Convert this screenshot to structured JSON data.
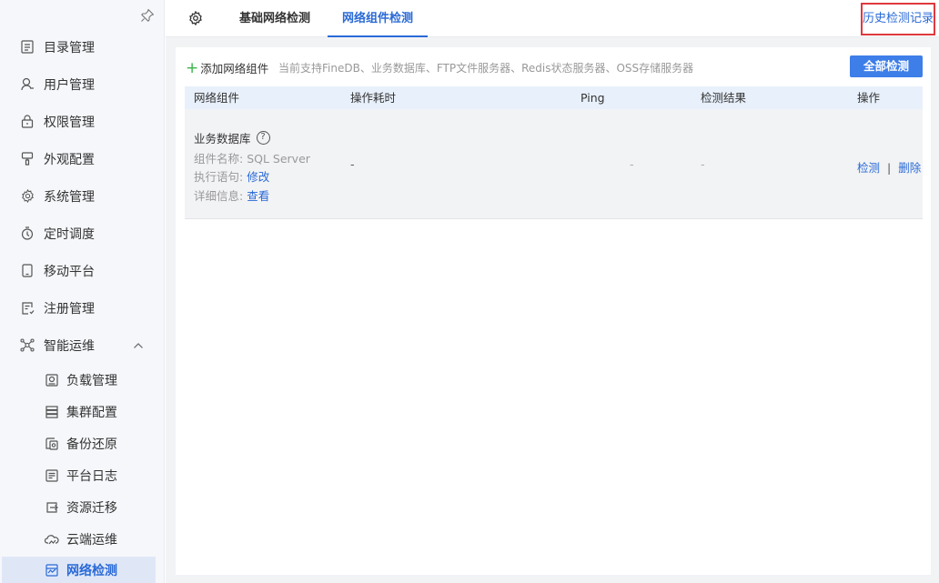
{
  "sidebar": {
    "items": [
      {
        "label": "目录管理",
        "icon": "catalog-icon"
      },
      {
        "label": "用户管理",
        "icon": "user-icon"
      },
      {
        "label": "权限管理",
        "icon": "lock-icon"
      },
      {
        "label": "外观配置",
        "icon": "brush-icon"
      },
      {
        "label": "系统管理",
        "icon": "gear-icon"
      },
      {
        "label": "定时调度",
        "icon": "timer-icon"
      },
      {
        "label": "移动平台",
        "icon": "mobile-icon"
      },
      {
        "label": "注册管理",
        "icon": "register-icon"
      },
      {
        "label": "智能运维",
        "icon": "ops-icon"
      }
    ],
    "sub_items": [
      {
        "label": "负载管理",
        "icon": "load-icon"
      },
      {
        "label": "集群配置",
        "icon": "cluster-icon"
      },
      {
        "label": "备份还原",
        "icon": "backup-icon"
      },
      {
        "label": "平台日志",
        "icon": "log-icon"
      },
      {
        "label": "资源迁移",
        "icon": "migrate-icon"
      },
      {
        "label": "云端运维",
        "icon": "cloud-icon"
      },
      {
        "label": "网络检测",
        "icon": "network-icon"
      }
    ]
  },
  "tabs": {
    "basic": "基础网络检测",
    "component": "网络组件检测",
    "active": "component"
  },
  "history_link": "历史检测记录",
  "toolbar": {
    "add_label": "添加网络组件",
    "support_text": "当前支持FineDB、业务数据库、FTP文件服务器、Redis状态服务器、OSS存储服务器",
    "check_all_label": "全部检测"
  },
  "table": {
    "headers": [
      "网络组件",
      "操作耗时",
      "Ping",
      "检测结果",
      "操作"
    ],
    "rows": [
      {
        "title": "业务数据库",
        "name_label": "组件名称:",
        "name_value": "SQL Server",
        "statement_label": "执行语句:",
        "statement_link": "修改",
        "detail_label": "详细信息:",
        "detail_link": "查看",
        "duration": "-",
        "ping": "-",
        "result": "-",
        "action_check": "检测",
        "action_sep": "|",
        "action_delete": "删除"
      }
    ]
  },
  "colors": {
    "accent": "#2a6ad6",
    "primary_button": "#3e7ee8",
    "add_plus": "#3bb34a",
    "highlight_border": "#e0383e"
  }
}
